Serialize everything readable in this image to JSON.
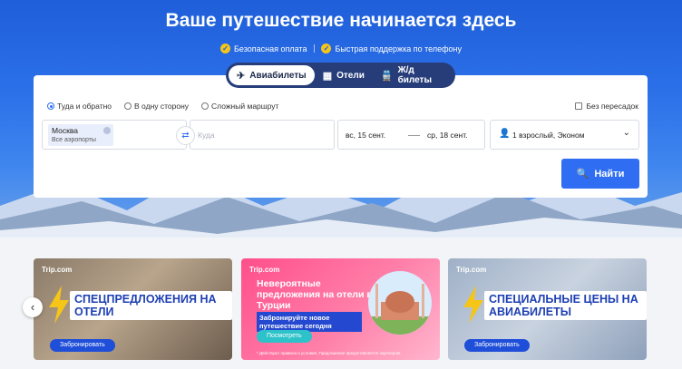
{
  "hero": {
    "title": "Ваше путешествие начинается здесь",
    "badges": [
      "Безопасная оплата",
      "Быстрая поддержка по телефону"
    ]
  },
  "tabs": [
    {
      "label": "Авиабилеты",
      "icon": "plane-icon",
      "active": true
    },
    {
      "label": "Отели",
      "icon": "hotel-icon",
      "active": false
    },
    {
      "label": "Ж/д билеты",
      "icon": "train-icon",
      "active": false
    }
  ],
  "search": {
    "trip_types": [
      "Туда и обратно",
      "В одну сторону",
      "Сложный маршрут"
    ],
    "selected_trip_type": "Туда и обратно",
    "nonstop_label": "Без пересадок",
    "from_city": "Москва",
    "from_sub": "Все аэропорты",
    "to_placeholder": "Куда",
    "depart_date": "вс, 15 сент.",
    "return_date": "ср, 18 сент.",
    "passengers": "1 взрослый, Эконом",
    "button_label": "Найти"
  },
  "promos": [
    {
      "brand": "Trip.com",
      "headline": "СПЕЦПРЕДЛОЖЕНИЯ НА ОТЕЛИ",
      "button": "Забронировать"
    },
    {
      "brand": "Trip.com",
      "title": "Невероятные предложения на отели в Турции",
      "subtitle": "Забронируйте новое путешествие сегодня",
      "button": "Посмотреть",
      "fine_print": "* Действуют правила и условия. Предложение предоставляется партнером."
    },
    {
      "brand": "Trip.com",
      "headline": "СПЕЦИАЛЬНЫЕ ЦЕНЫ НА АВИАБИЛЕТЫ",
      "button": "Забронировать"
    }
  ],
  "colors": {
    "accent": "#2f6ef3",
    "hero": "#1f5fd9",
    "promo_pink": "#ff4f8b"
  }
}
